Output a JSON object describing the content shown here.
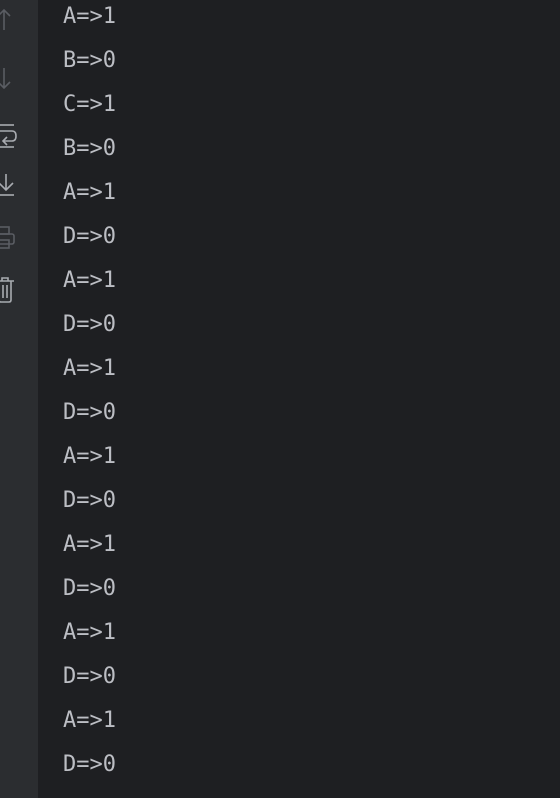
{
  "toolbar": {
    "icons": [
      "up-arrow-icon",
      "down-arrow-icon",
      "soft-wrap-icon",
      "scroll-to-end-icon",
      "print-icon",
      "clear-all-icon"
    ]
  },
  "console": {
    "lines": [
      "A=>1",
      "B=>0",
      "C=>1",
      "B=>0",
      "A=>1",
      "D=>0",
      "A=>1",
      "D=>0",
      "A=>1",
      "D=>0",
      "A=>1",
      "D=>0",
      "A=>1",
      "D=>0",
      "A=>1",
      "D=>0",
      "A=>1",
      "D=>0"
    ]
  },
  "colors": {
    "background": "#1e1f22",
    "toolbar": "#2b2d30",
    "text": "#bcbec4",
    "icon": "#a8abb0",
    "icon_disabled": "#5a5d63"
  }
}
